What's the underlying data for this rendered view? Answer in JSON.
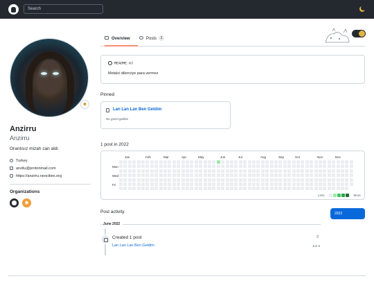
{
  "header": {
    "search_placeholder": "Search",
    "logo_icon": "github-mark-icon",
    "theme_icon": "moon-icon"
  },
  "tabs": [
    {
      "label": "Overview",
      "icon": "book-icon",
      "selected": true
    },
    {
      "label": "Posts",
      "icon": "posts-icon",
      "count": "1"
    }
  ],
  "profile": {
    "name": "Anzirru",
    "login": "Anzirru",
    "bio": "Orantısız mizah can aldı",
    "status_icon": "status-emoji-icon",
    "location": "Turkey",
    "email": "anzilu@protonmail.com",
    "website": "https://anzirru.neocities.org"
  },
  "organizations": {
    "title": "Organizations",
    "items": [
      {
        "name": "github-org",
        "icon": "github-org-icon"
      },
      {
        "name": "rss-org",
        "icon": "rss-icon"
      }
    ]
  },
  "readme": {
    "filename": "README",
    "ext": ".md",
    "text": "Metalci dilenciye para vermez"
  },
  "pinned": {
    "title": "Pinned",
    "items": [
      {
        "title": "Lan Lan Lan Ben Geldim",
        "description": "Ne güzel geldim"
      }
    ]
  },
  "contributions": {
    "title": "1 post in 2022",
    "months": [
      "Jan",
      "Feb",
      "Mar",
      "Apr",
      "May",
      "Jun",
      "Jul",
      "Aug",
      "Sep",
      "Oct",
      "Nov",
      "Dec"
    ],
    "days": [
      "Mon",
      "Wed",
      "Fri"
    ],
    "weeks": 53,
    "active_week": 22,
    "active_day": 0,
    "legend_less": "Less",
    "legend_more": "More",
    "colors": [
      "#ebedf0",
      "#9be9a8",
      "#40c463",
      "#30a14e",
      "#216e39"
    ]
  },
  "year_selector": {
    "selected": "2022",
    "accent": "#0969da"
  },
  "activity": {
    "title": "Post activity",
    "month": "June 2022",
    "summary": "Created 1 post",
    "item_title": "Lan Lan Lan Ben Geldim",
    "item_date": "Jun 5"
  }
}
